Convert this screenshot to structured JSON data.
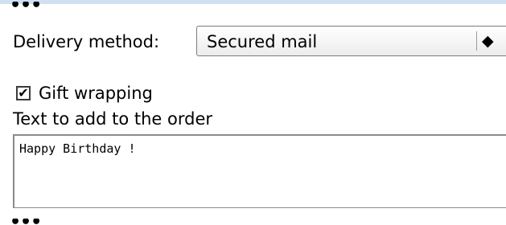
{
  "colors": {
    "top_border": "#cfe0f1",
    "field_border": "#7d7d7d"
  },
  "ellipsis_top": "•••",
  "delivery": {
    "label": "Delivery method:",
    "selected": "Secured mail",
    "arrows_glyph": "▴▾"
  },
  "gift_wrapping": {
    "checked": true,
    "check_glyph": "✔",
    "label": "Gift wrapping"
  },
  "order_text": {
    "label": "Text to add to the order",
    "value": "Happy Birthday !"
  },
  "ellipsis_bottom": "•••"
}
